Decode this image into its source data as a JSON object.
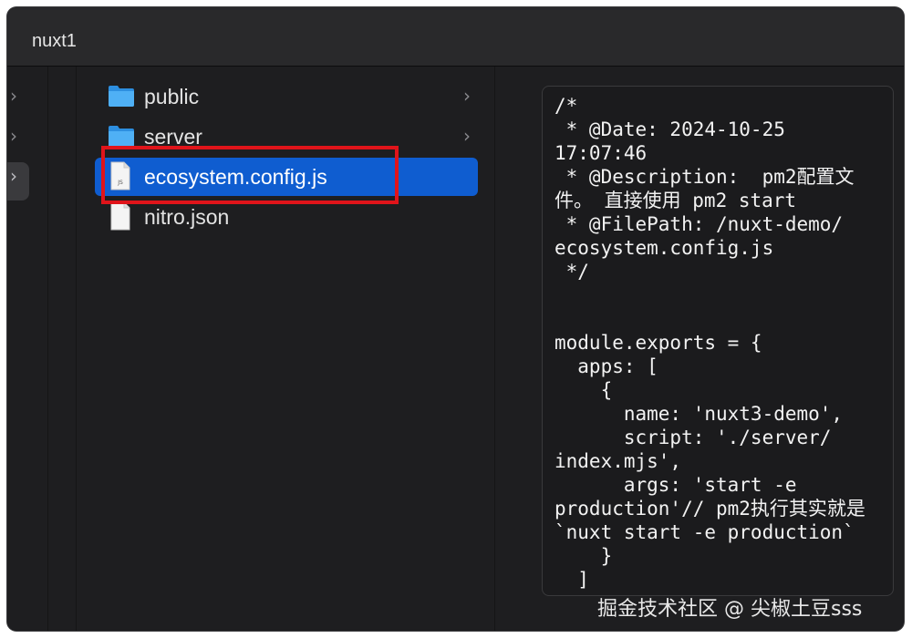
{
  "window": {
    "title": "nuxt1"
  },
  "files": [
    {
      "name": "public",
      "kind": "folder",
      "has_children": true,
      "selected": false
    },
    {
      "name": "server",
      "kind": "folder",
      "has_children": true,
      "selected": false
    },
    {
      "name": "ecosystem.config.js",
      "kind": "js-file",
      "icon_label": "JS",
      "selected": true
    },
    {
      "name": "nitro.json",
      "kind": "file",
      "selected": false
    }
  ],
  "preview": {
    "code_lines": [
      "/*",
      " * @Date: 2024-10-25",
      "17:07:46",
      " * @Description:  pm2配置文",
      "件。 直接使用 pm2 start",
      " * @FilePath: /nuxt-demo/",
      "ecosystem.config.js",
      " */",
      "",
      "",
      "module.exports = {",
      "  apps: [",
      "    {",
      "      name: 'nuxt3-demo',",
      "      script: './server/",
      "index.mjs',",
      "      args: 'start -e",
      "production'// pm2执行其实就是",
      "`nuxt start -e production`",
      "    }",
      "  ]"
    ]
  },
  "watermark": "掘金技术社区 @ 尖椒土豆sss",
  "colors": {
    "selection": "#0f5dd0",
    "highlight_border": "#e0141a",
    "folder": "#3aa0f0",
    "window_bg": "#1e1e20"
  }
}
